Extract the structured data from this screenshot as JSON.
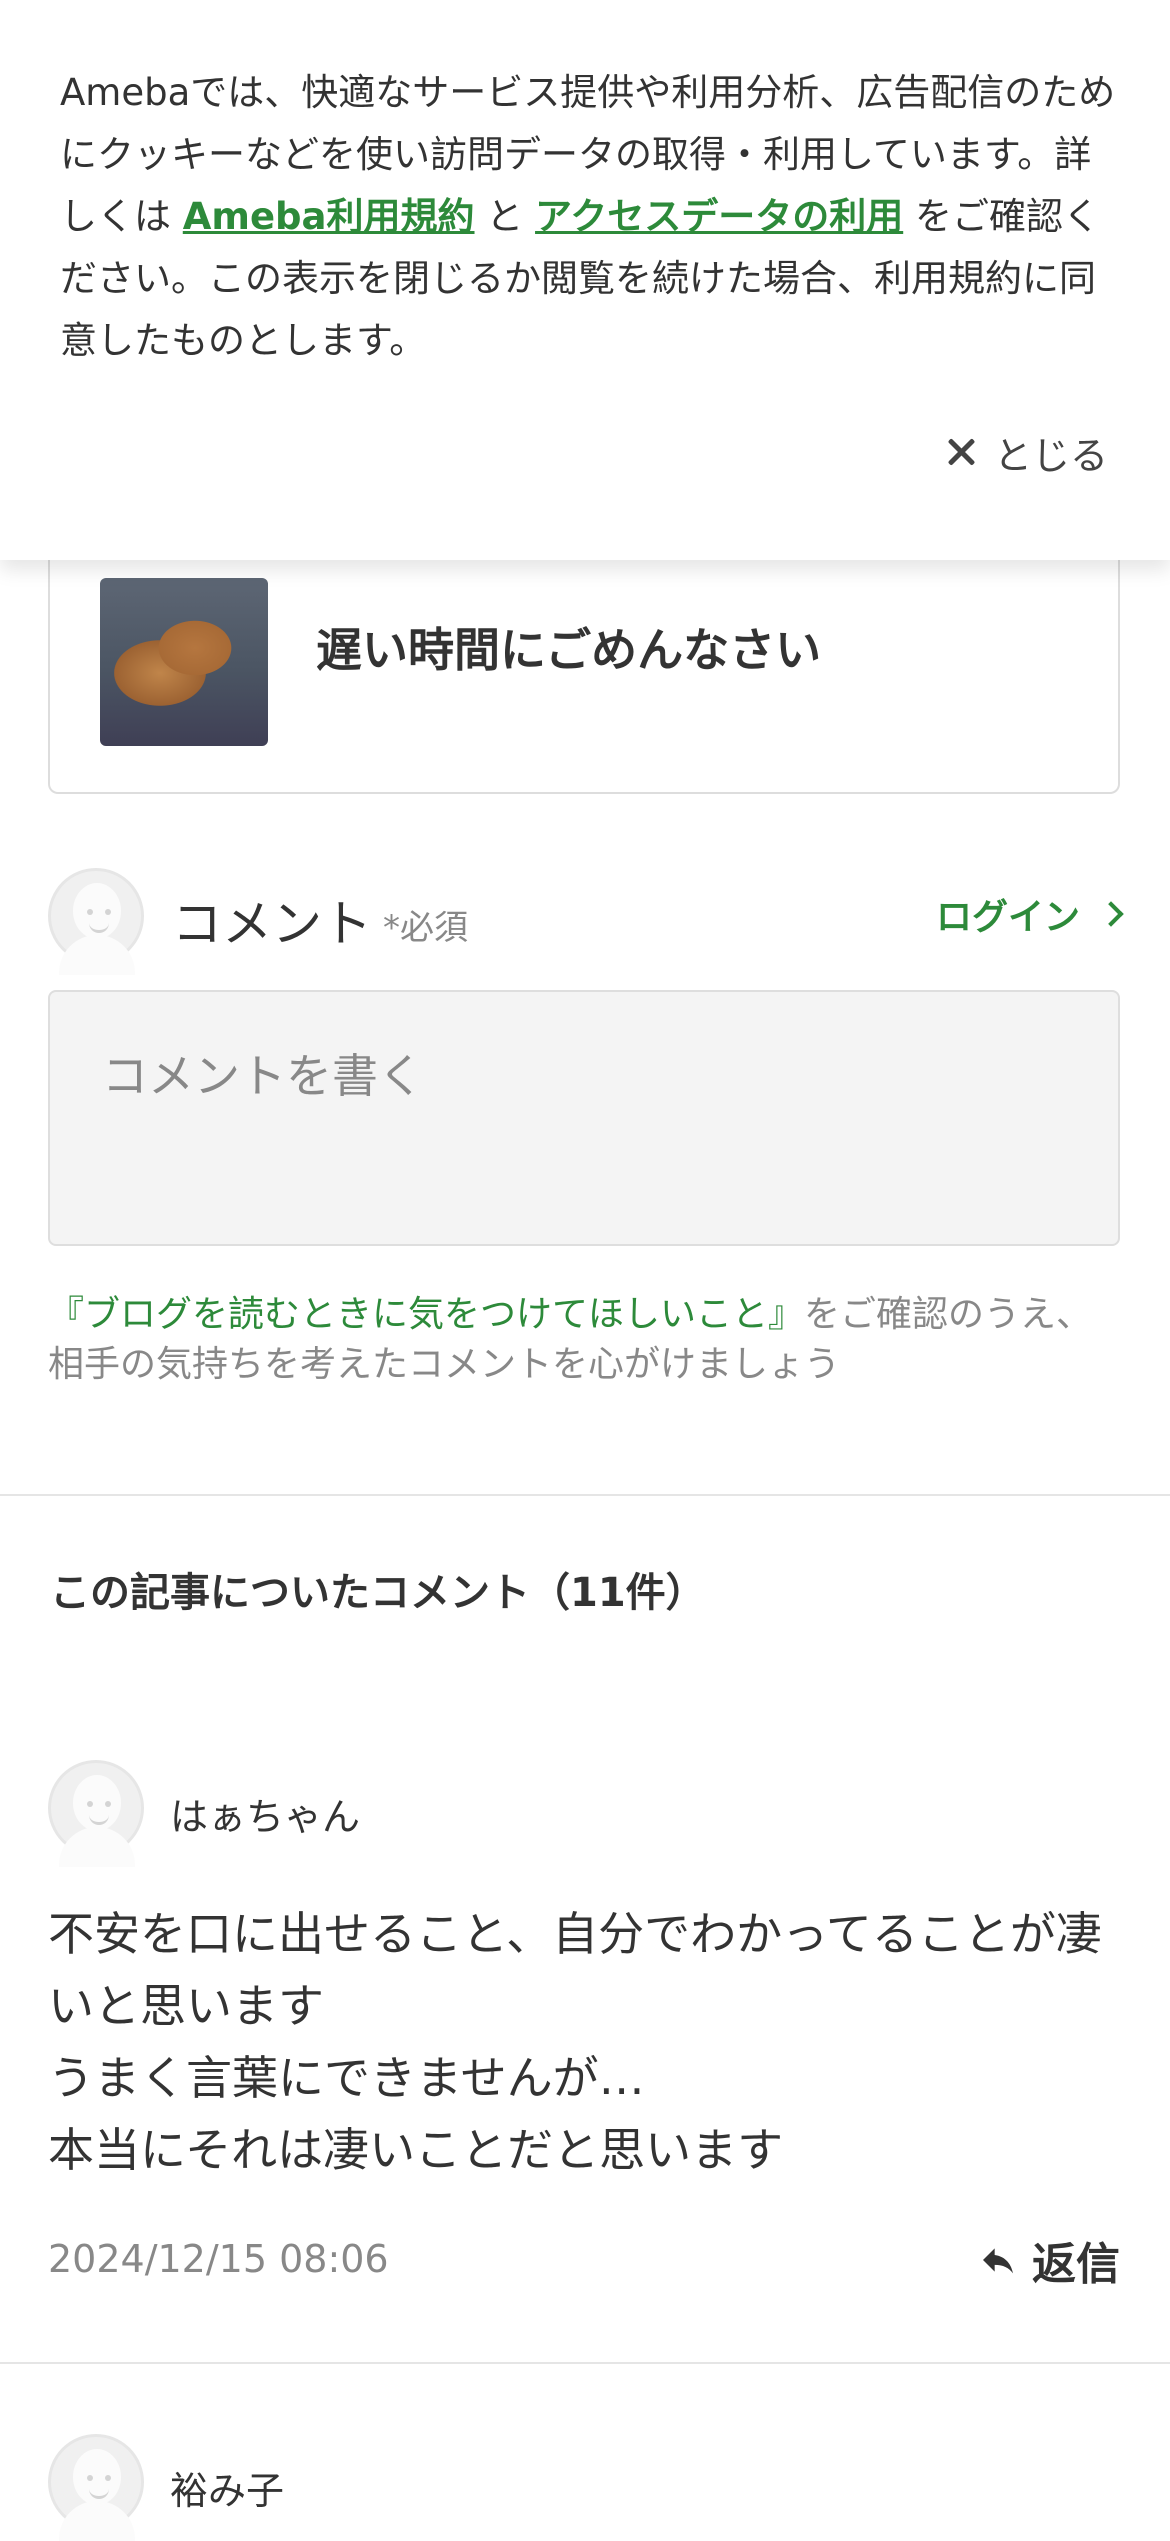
{
  "cookie": {
    "text_1": "Amebaでは、快適なサービス提供や利用分析、広告配信のためにクッキーなどを使い訪問データの取得・利用しています。詳しくは",
    "link_terms": "Ameba利用規約",
    "text_and": "と",
    "link_access": "アクセスデータの利用",
    "text_2": "をご確認ください。この表示を閉じるか閲覧を続けた場合、利用規約に同意したものとします。",
    "close_label": "とじる"
  },
  "article": {
    "title": "遅い時間にごめんなさい"
  },
  "comment_form": {
    "label": "コメント",
    "required": "*必須",
    "login_label": "ログイン",
    "placeholder": "コメントを書く",
    "guideline_link": "『ブログを読むときに気をつけてほしいこと』",
    "guideline_text": "をご確認のうえ、相手の気持ちを考えたコメントを心がけましょう"
  },
  "comments_section": {
    "title": "この記事についたコメント（11件）"
  },
  "comments": [
    {
      "author": "はぁちゃん",
      "lines": [
        "不安を口に出せること、自分でわかってることが凄いと思います",
        "うまく言葉にできませんが…",
        "本当にそれは凄いことだと思います"
      ],
      "date": "2024/12/15 08:06",
      "reply_label": "返信"
    },
    {
      "author": "裕み子"
    }
  ],
  "colors": {
    "accent": "#2d8a3a",
    "text": "#333333",
    "muted": "#888888"
  }
}
